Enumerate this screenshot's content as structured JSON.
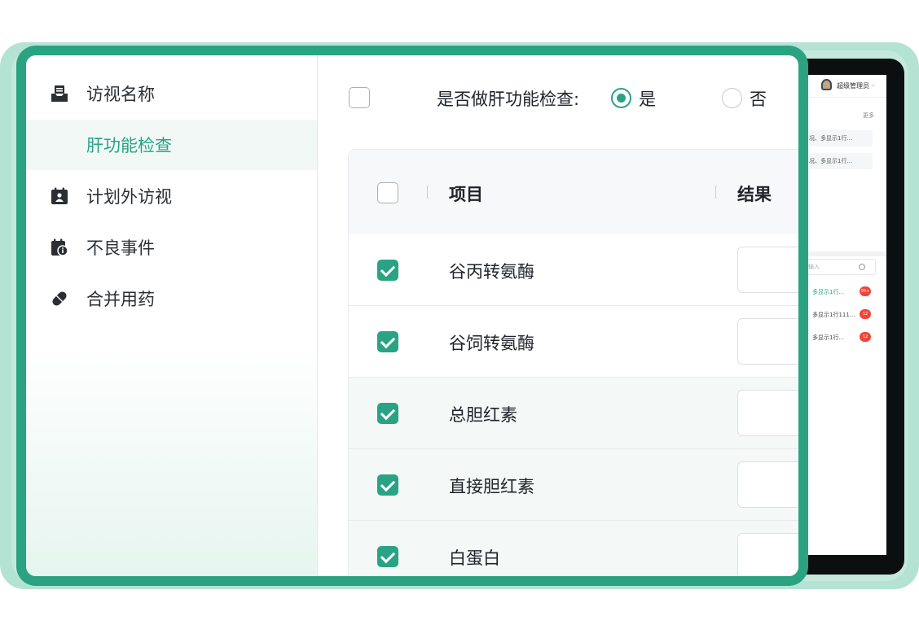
{
  "sidebar": {
    "items": [
      {
        "label": "访视名称",
        "icon": "inbox-tray-icon"
      },
      {
        "label": "肝功能检查",
        "icon": ""
      },
      {
        "label": "计划外访视",
        "icon": "calendar-person-icon"
      },
      {
        "label": "不良事件",
        "icon": "calendar-alert-icon"
      },
      {
        "label": "合并用药",
        "icon": "pill-icon"
      }
    ]
  },
  "form": {
    "question": "是否做肝功能检查:",
    "options": [
      "是",
      "否"
    ],
    "selected": "是"
  },
  "table": {
    "headers": [
      "项目",
      "结果"
    ],
    "rows": [
      {
        "name": "谷丙转氨酶",
        "checked": true
      },
      {
        "name": "谷饲转氨酶",
        "checked": true
      },
      {
        "name": "总胆红素",
        "checked": true
      },
      {
        "name": "直接胆红素",
        "checked": true
      },
      {
        "name": "白蛋白",
        "checked": true
      }
    ]
  },
  "device": {
    "username": "超级管理员",
    "more": "更多",
    "notices": [
      "况、多显示1行...",
      "况、多显示1行..."
    ],
    "search_placeholder": "输入",
    "list": [
      {
        "text": "多显示1行...",
        "badge": "99+"
      },
      {
        "text": "多显示1行111...",
        "badge": "12"
      },
      {
        "text": "多显示1行...",
        "badge": "12"
      }
    ]
  },
  "colors": {
    "accent": "#2aa384",
    "frame": "#2ba383",
    "backdrop": "#b5e3d3",
    "badge": "#f04438"
  }
}
